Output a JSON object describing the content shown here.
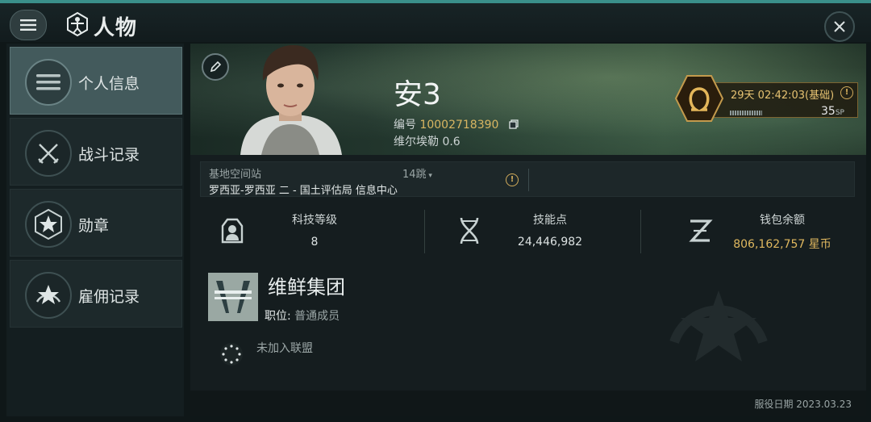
{
  "header": {
    "title": "人物",
    "menu_icon": "menu-icon",
    "app_icon": "vitruvian-icon",
    "close_icon": "close-icon"
  },
  "sidebar": {
    "items": [
      {
        "label": "个人信息",
        "icon": "list-icon",
        "active": true
      },
      {
        "label": "战斗记录",
        "icon": "crossed-swords-icon",
        "active": false
      },
      {
        "label": "勋章",
        "icon": "star-hexagon-icon",
        "active": false
      },
      {
        "label": "雇佣记录",
        "icon": "star-laurel-icon",
        "active": false
      }
    ]
  },
  "profile": {
    "name": "安3",
    "id_label": "编号",
    "id_value": "10002718390",
    "security": "维尔埃勒 0.6",
    "omega_label": "29天 02:42:03(基础)",
    "sp_value": "35",
    "sp_unit": "SP"
  },
  "station": {
    "label": "基地空间站",
    "jumps": "14跳",
    "name": "罗西亚-罗西亚 二 - 国土评估局 信息中心"
  },
  "stats": [
    {
      "label": "科技等级",
      "value": "8",
      "icon": "tech-level-icon"
    },
    {
      "label": "技能点",
      "value": "24,446,982",
      "icon": "dna-icon"
    },
    {
      "label": "钱包余额",
      "value": "806,162,757 星币",
      "icon": "isk-icon"
    }
  ],
  "corp": {
    "name": "维鲜集团",
    "position_label": "职位:",
    "position_value": "普通成员",
    "alliance": "未加入联盟"
  },
  "footer": {
    "service_date": "服役日期 2023.03.23"
  },
  "colors": {
    "accent": "#3a8f8a",
    "gold": "#d9b662",
    "active_tab": "#435a5c"
  }
}
